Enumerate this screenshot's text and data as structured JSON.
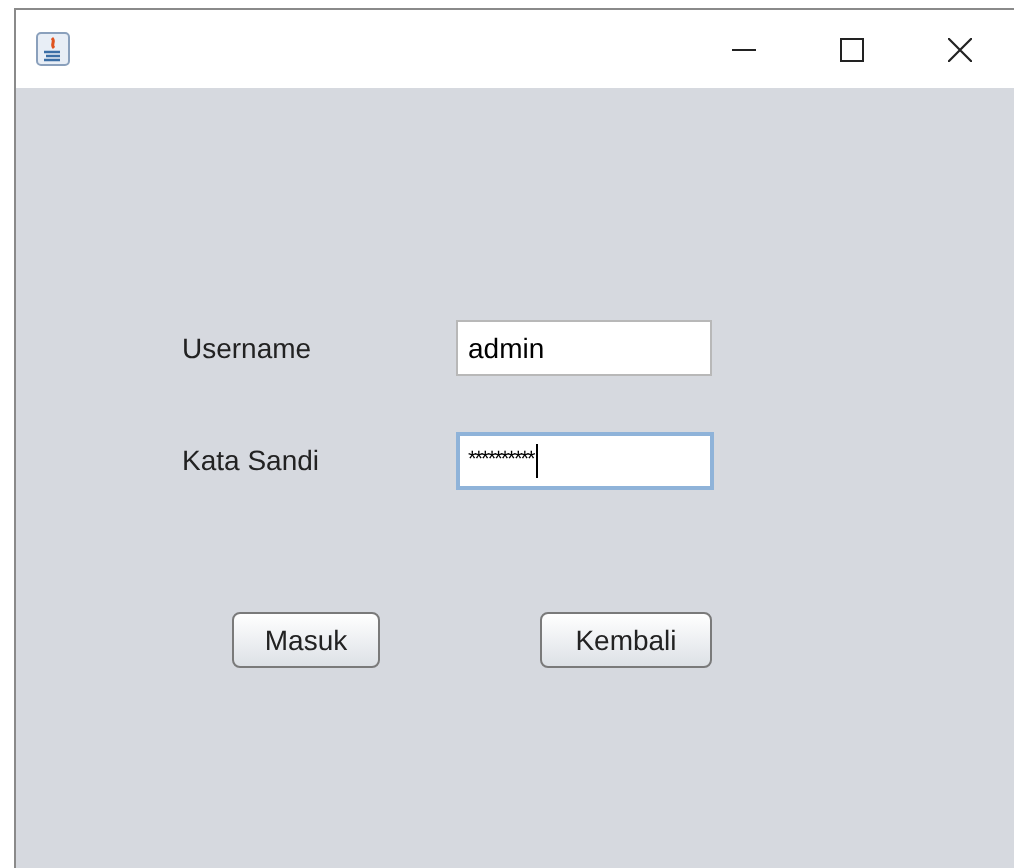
{
  "fields": [
    {
      "label": "Username",
      "kind": "text",
      "value": "admin",
      "focused": false
    },
    {
      "label": "Kata Sandi",
      "kind": "password",
      "value": "**********",
      "focused": true
    }
  ],
  "buttons": [
    "Masuk",
    "Kembali"
  ]
}
